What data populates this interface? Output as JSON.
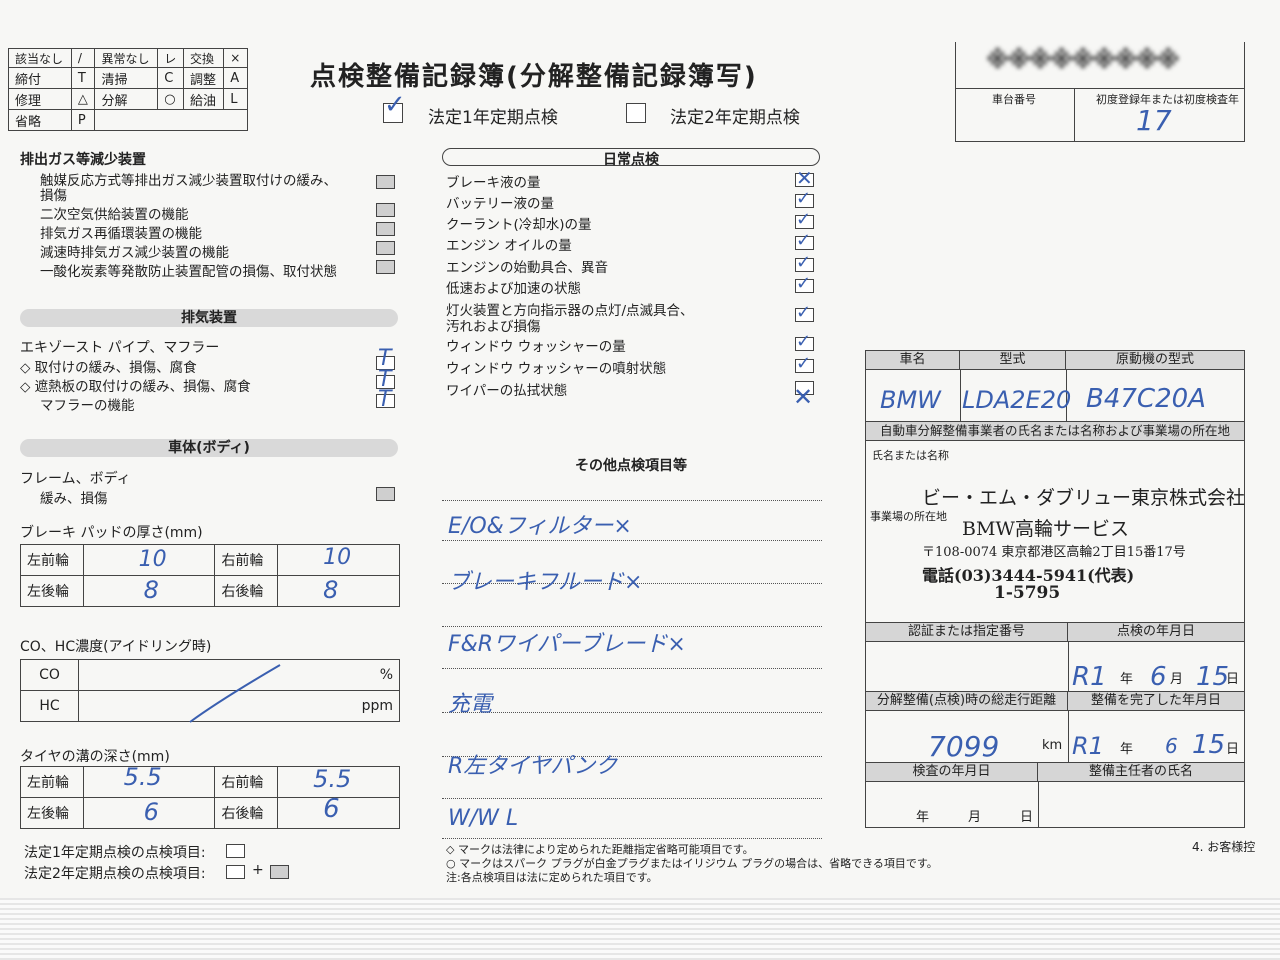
{
  "legend": {
    "rows": [
      [
        "該当なし",
        "/",
        "異常なし",
        "レ",
        "交換",
        "×"
      ],
      [
        "締付",
        "T",
        "清掃",
        "C",
        "調整",
        "A"
      ],
      [
        "修理",
        "△",
        "分解",
        "○",
        "給油",
        "L"
      ],
      [
        "省略",
        "P",
        "",
        "",
        "",
        ""
      ]
    ]
  },
  "header": {
    "title": "点検整備記録簿(分解整備記録簿写)",
    "option1": "法定1年定期点検",
    "option2": "法定2年定期点検",
    "option1_checked": true,
    "reg_label": "車台番号",
    "first_reg_label": "初度登録年または初度検査年",
    "first_reg_value": "17",
    "blurred_text": "※※※※※※※※※"
  },
  "emission": {
    "title": "排出ガス等減少装置",
    "items": [
      "触媒反応方式等排出ガス減少装置取付けの緩み、",
      "損傷",
      "二次空気供給装置の機能",
      "排気ガス再循環装置の機能",
      "減速時排気ガス減少装置の機能",
      "一酸化炭素等発散防止装置配管の損傷、取付状態"
    ]
  },
  "exhaust": {
    "title": "排気装置",
    "sub": "エキゾースト パイプ、マフラー",
    "items": [
      "◇ 取付けの緩み、損傷、腐食",
      "◇ 遮熱板の取付けの緩み、損傷、腐食",
      "マフラーの機能"
    ],
    "marks": "T"
  },
  "body_section": {
    "title": "車体(ボディ)",
    "sub": "フレーム、ボディ",
    "item": "緩み、損傷"
  },
  "brake": {
    "title": "ブレーキ パッドの厚さ(mm)",
    "lf_label": "左前輪",
    "lf": "10",
    "rf_label": "右前輪",
    "rf": "10",
    "lr_label": "左後輪",
    "lr": "8",
    "rr_label": "右後輪",
    "rr": "8"
  },
  "co_hc": {
    "title": "CO、HC濃度(アイドリング時)",
    "co": "CO",
    "co_unit": "%",
    "hc": "HC",
    "hc_unit": "ppm"
  },
  "tire": {
    "title": "タイヤの溝の深さ(mm)",
    "lf_label": "左前輪",
    "lf": "5.5",
    "rf_label": "右前輪",
    "rf": "5.5",
    "lr_label": "左後輪",
    "lr": "6",
    "rr_label": "右後輪",
    "rr": "6"
  },
  "bottom_legend": {
    "l1": "法定1年定期点検の点検項目:",
    "l2": "法定2年定期点検の点検項目:",
    "plus": "+"
  },
  "daily": {
    "title": "日常点検",
    "items": [
      "ブレーキ液の量",
      "バッテリー液の量",
      "クーラント(冷却水)の量",
      "エンジン オイルの量",
      "エンジンの始動具合、異音",
      "低速および加速の状態",
      "灯火装置と方向指示器の点灯/点滅具合、",
      "汚れおよび損傷",
      "ウィンドウ ウォッシャーの量",
      "ウィンドウ ウォッシャーの噴射状態",
      "ワイパーの払拭状態"
    ]
  },
  "other": {
    "title": "その他点検項目等",
    "lines": [
      "E/O&フィルター×",
      "ブレーキフルード×",
      "F&Rワイパーブレード×",
      "充電",
      "R左タイヤパンク",
      "W/W L"
    ]
  },
  "notes": [
    "◇ マークは法律により定められた距離指定省略可能項目です。",
    "○ マークはスパーク プラグが白金プラグまたはイリジウム プラグの場合は、省略できる項目です。",
    "注:各点検項目は法に定められた項目です。"
  ],
  "vehicle": {
    "name_label": "車名",
    "type_label": "型式",
    "engine_label": "原動機の型式",
    "name": "BMW",
    "type": "LDA2E20",
    "engine": "B47C20A",
    "dealer_header": "自動車分解整備事業者の氏名または名称および事業場の所在地",
    "name_or_title": "氏名または名称",
    "location_label": "事業場の所在地",
    "company": "ビー・エム・ダブリュー東京株式会社",
    "branch": "BMW高輪サービス",
    "address": "〒108-0074 東京都港区高輪2丁目15番17号",
    "phone": "電話(03)3444-5941(代表)",
    "cert": "1-5795",
    "cert_label": "認証または指定番号",
    "inspect_date_label": "点検の年月日",
    "inspect_era": "R1",
    "inspect_month": "6",
    "inspect_day": "15",
    "year": "年",
    "month": "月",
    "day": "日",
    "mileage_label": "分解整備(点検)時の総走行距離",
    "mileage": "7099",
    "km": "km",
    "done_label": "整備を完了した年月日",
    "done_era": "R1",
    "done_month": "6",
    "done_day": "15",
    "check_date_label": "検査の年月日",
    "chief_label": "整備主任者の氏名"
  },
  "footer": {
    "right": "4. お客様控"
  }
}
